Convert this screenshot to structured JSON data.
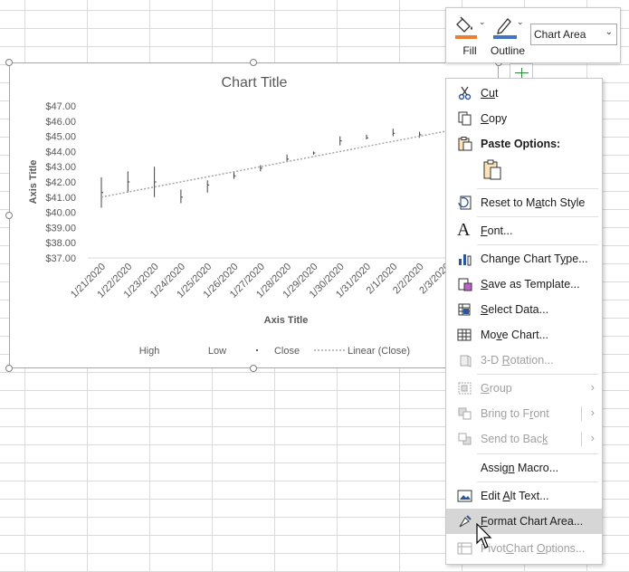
{
  "chart": {
    "title": "Chart Title",
    "y_axis_title": "Axis Title",
    "x_axis_title": "Axis Title",
    "legend": [
      "High",
      "Low",
      "Close",
      "Linear (Close)"
    ]
  },
  "chart_data": {
    "type": "line",
    "title": "Chart Title",
    "xlabel": "Axis Title",
    "ylabel": "Axis Title",
    "ylim": [
      37,
      47
    ],
    "y_ticks": [
      "$37.00",
      "$38.00",
      "$39.00",
      "$40.00",
      "$41.00",
      "$42.00",
      "$43.00",
      "$44.00",
      "$45.00",
      "$46.00",
      "$47.00"
    ],
    "categories": [
      "1/21/2020",
      "1/22/2020",
      "1/23/2020",
      "1/24/2020",
      "1/25/2020",
      "1/26/2020",
      "1/27/2020",
      "1/28/2020",
      "1/29/2020",
      "1/30/2020",
      "1/31/2020",
      "2/1/2020",
      "2/2/2020",
      "2/3/2020"
    ],
    "series": [
      {
        "name": "High",
        "values": [
          42.3,
          42.7,
          43.0,
          41.5,
          42.1,
          42.7,
          43.1,
          43.8,
          44.0,
          45.0,
          45.1,
          45.5,
          45.3,
          45.6
        ]
      },
      {
        "name": "Low",
        "values": [
          40.3,
          41.3,
          41.0,
          40.6,
          41.3,
          42.2,
          42.7,
          43.3,
          43.8,
          44.4,
          44.8,
          45.0,
          44.9,
          45.2
        ]
      },
      {
        "name": "Close",
        "values": [
          41.3,
          42.0,
          42.0,
          41.0,
          41.8,
          42.4,
          42.9,
          43.5,
          43.9,
          44.7,
          44.9,
          45.2,
          45.1,
          45.4
        ]
      },
      {
        "name": "Linear (Close)",
        "values": [
          41.0,
          45.45
        ]
      }
    ],
    "legend_position": "bottom",
    "grid": false
  },
  "mini_toolbar": {
    "fill_label": "Fill",
    "outline_label": "Outline",
    "element_select": "Chart Area"
  },
  "context_menu": {
    "cut": [
      "",
      "Cu",
      "t",
      ""
    ],
    "copy": [
      "",
      "C",
      "opy",
      ""
    ],
    "paste_options": "Paste Options:",
    "reset": [
      "Reset to M",
      "a",
      "tch Style",
      ""
    ],
    "font": [
      "",
      "F",
      "ont...",
      ""
    ],
    "change_type": [
      "Change Chart T",
      "y",
      "pe...",
      ""
    ],
    "save_template": [
      "",
      "S",
      "ave as Template...",
      ""
    ],
    "select_data": [
      "",
      "S",
      "elect Data...",
      ""
    ],
    "move_chart": [
      "Mo",
      "v",
      "e Chart...",
      ""
    ],
    "rotation": [
      "3-D ",
      "R",
      "otation...",
      ""
    ],
    "group": [
      "",
      "G",
      "roup",
      ""
    ],
    "bring_front": [
      "Bring to F",
      "r",
      "ont",
      ""
    ],
    "send_back": [
      "Send to Bac",
      "k",
      "",
      ""
    ],
    "assign_macro": [
      "Assig",
      "n",
      " Macro...",
      ""
    ],
    "alt_text": [
      "Edit ",
      "A",
      "lt Text...",
      ""
    ],
    "format_area": [
      "",
      "F",
      "ormat Chart Area...",
      ""
    ],
    "pivot_options": [
      "Pivot",
      "C",
      "hart ",
      "O",
      "ptions..."
    ]
  },
  "colors": {
    "fill_accent": "#ed7d31",
    "outline_accent": "#4472c4",
    "menu_highlight": "#d6d6d6"
  }
}
